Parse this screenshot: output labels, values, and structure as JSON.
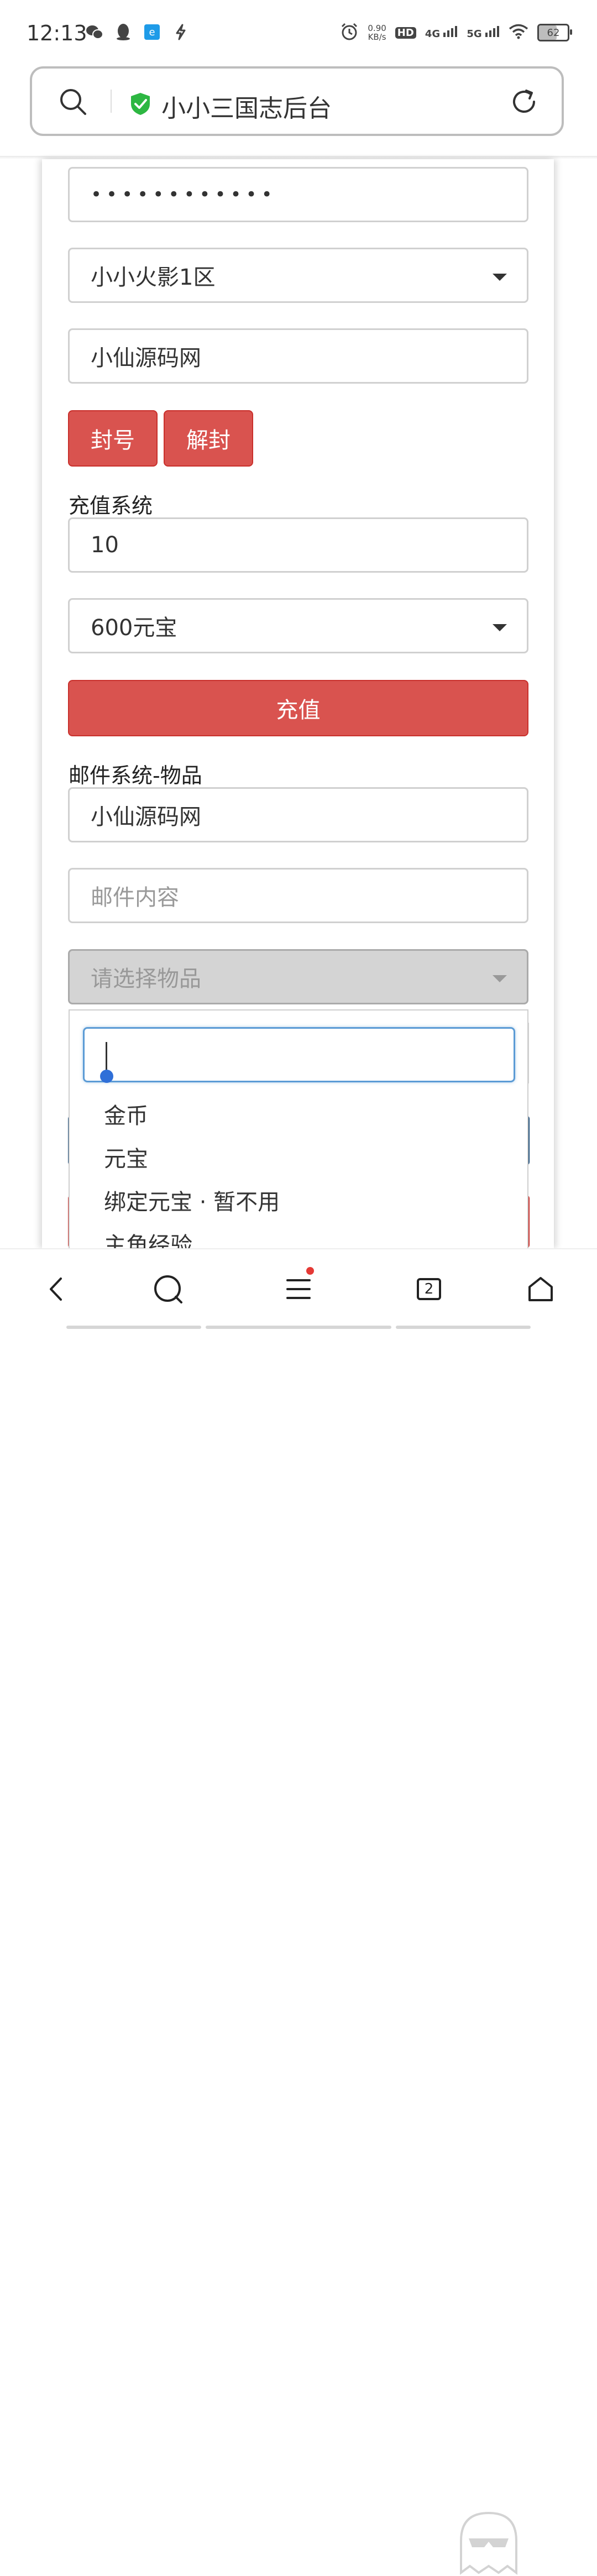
{
  "status_bar": {
    "time": "12:13",
    "speed_value": "0.90",
    "speed_unit": "KB/s",
    "hd_label": "HD",
    "net_4g": "4G",
    "net_5g": "5G",
    "battery": "62",
    "battery_level": 0.62
  },
  "browser": {
    "title": "小小三国志后台"
  },
  "form": {
    "password_masked": "••••••••••••",
    "server_select": "小小火影1区",
    "account_name": "小仙源码网",
    "ban_label": "封号",
    "unban_label": "解封",
    "recharge_section": "充值系统",
    "recharge_amount": "10",
    "recharge_package": "600元宝",
    "recharge_button": "充值",
    "mail_section": "邮件系统-物品",
    "mail_recipient": "小仙源码网",
    "mail_content_placeholder": "邮件内容",
    "item_select_placeholder": "请选择物品"
  },
  "dropdown": {
    "search_value": "",
    "options": [
      "金币",
      "元宝",
      "绑定元宝 · 暂不用",
      "主角经验"
    ]
  },
  "bottom_nav": {
    "tab_count": "2"
  },
  "colors": {
    "danger": "#d9534f",
    "focus": "#5b9bd5",
    "secure_green": "#2db742"
  }
}
